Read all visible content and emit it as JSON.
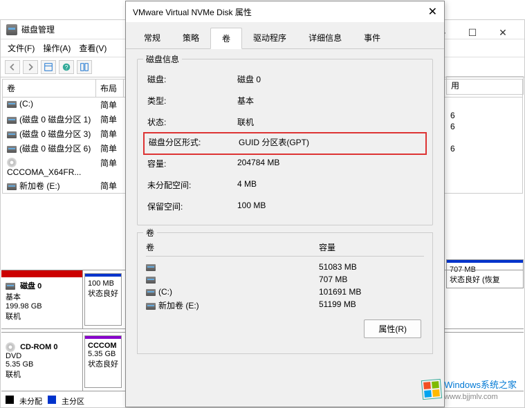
{
  "bg_window": {
    "title": "磁盘管理",
    "menu": {
      "file": "文件(F)",
      "action": "操作(A)",
      "view": "查看(V)"
    }
  },
  "volume_list": {
    "header": {
      "volume": "卷",
      "layout": "布局"
    },
    "rows": [
      {
        "name": "(C:)",
        "layout": "简单"
      },
      {
        "name": "(磁盘 0 磁盘分区 1)",
        "layout": "简单"
      },
      {
        "name": "(磁盘 0 磁盘分区 3)",
        "layout": "简单"
      },
      {
        "name": "(磁盘 0 磁盘分区 6)",
        "layout": "简单"
      },
      {
        "name": "CCCOMA_X64FR...",
        "layout": "简单"
      },
      {
        "name": "新加卷 (E:)",
        "layout": "简单"
      }
    ]
  },
  "right_col": {
    "header": "用",
    "r1": "6",
    "r2": "6",
    "r4": "6"
  },
  "disk0": {
    "name": "磁盘 0",
    "type": "基本",
    "size": "199.98 GB",
    "status": "联机",
    "part1_size": "100 MB",
    "part1_status": "状态良好"
  },
  "cdrom": {
    "name": "CD-ROM 0",
    "type": "DVD",
    "size": "5.35 GB",
    "status": "联机",
    "part_name": "CCCOM",
    "part_size": "5.35 GB",
    "part_status": "状态良好"
  },
  "right_part": {
    "size": "707 MB",
    "status": "状态良好 (恢复"
  },
  "legend": {
    "unalloc": "未分配",
    "primary": "主分区"
  },
  "dialog": {
    "title": "VMware Virtual NVMe Disk 属性",
    "tabs": {
      "general": "常规",
      "policies": "策略",
      "volumes": "卷",
      "driver": "驱动程序",
      "details": "详细信息",
      "events": "事件"
    },
    "group_title": "磁盘信息",
    "info": {
      "disk_label": "磁盘:",
      "disk_value": "磁盘 0",
      "type_label": "类型:",
      "type_value": "基本",
      "status_label": "状态:",
      "status_value": "联机",
      "partstyle_label": "磁盘分区形式:",
      "partstyle_value": "GUID 分区表(GPT)",
      "capacity_label": "容量:",
      "capacity_value": "204784 MB",
      "unalloc_label": "未分配空间:",
      "unalloc_value": "4 MB",
      "reserved_label": "保留空间:",
      "reserved_value": "100 MB"
    },
    "vol_group_title": "卷",
    "vol_header": {
      "volume": "卷",
      "capacity": "容量"
    },
    "vols": [
      {
        "name": "",
        "cap": "51083 MB"
      },
      {
        "name": "",
        "cap": "707 MB"
      },
      {
        "name": "(C:)",
        "cap": "101691 MB"
      },
      {
        "name": "新加卷 (E:)",
        "cap": "51199 MB"
      }
    ],
    "prop_button": "属性(R)"
  },
  "watermark": {
    "brand": "Windows",
    "sub": "系统之家",
    "url": "www.bjjmlv.com"
  }
}
